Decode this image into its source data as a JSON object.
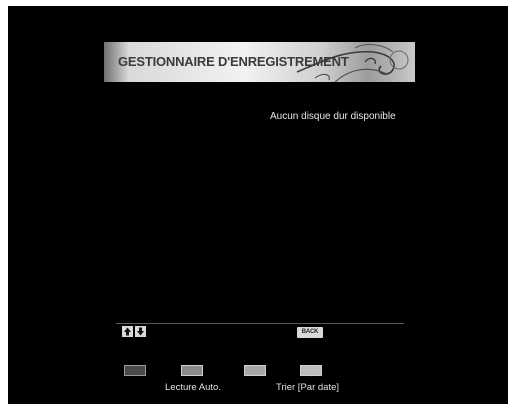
{
  "header": {
    "title": "GESTIONNAIRE D'ENREGISTREMENT"
  },
  "main": {
    "message": "Aucun disque dur disponible"
  },
  "footer": {
    "nav_icon": "up-down-arrows-icon",
    "back_label": "BACK",
    "color_keys": [
      {
        "name": "red-key-icon",
        "label": ""
      },
      {
        "name": "green-key-icon",
        "label": "Lecture Auto."
      },
      {
        "name": "yellow-key-icon",
        "label": ""
      },
      {
        "name": "blue-key-icon",
        "label": "Trier [Par date]"
      }
    ]
  }
}
